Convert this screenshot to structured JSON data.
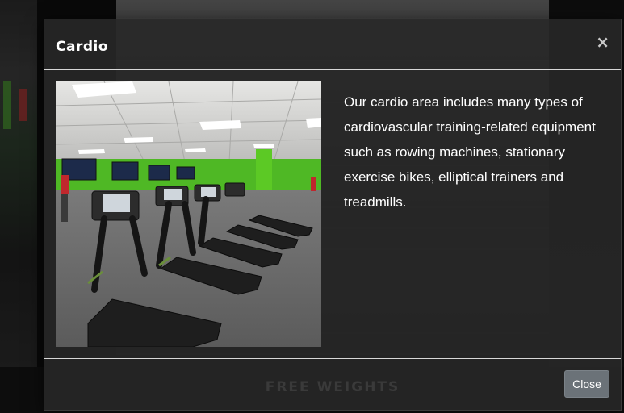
{
  "modal": {
    "title": "Cardio",
    "close_icon": "×",
    "description": "Our cardio area includes many types of cardiovascular training-related equipment such as rowing machines, stationary exercise bikes, elliptical trainers and treadmills.",
    "close_button_label": "Close",
    "image_alt": "Cardio area with rows of treadmills"
  },
  "background": {
    "section_label": "FREE WEIGHTS"
  },
  "colors": {
    "modal_bg": "#2b2b2b",
    "accent_green": "#54c21f",
    "close_button_bg": "#6b7278"
  }
}
